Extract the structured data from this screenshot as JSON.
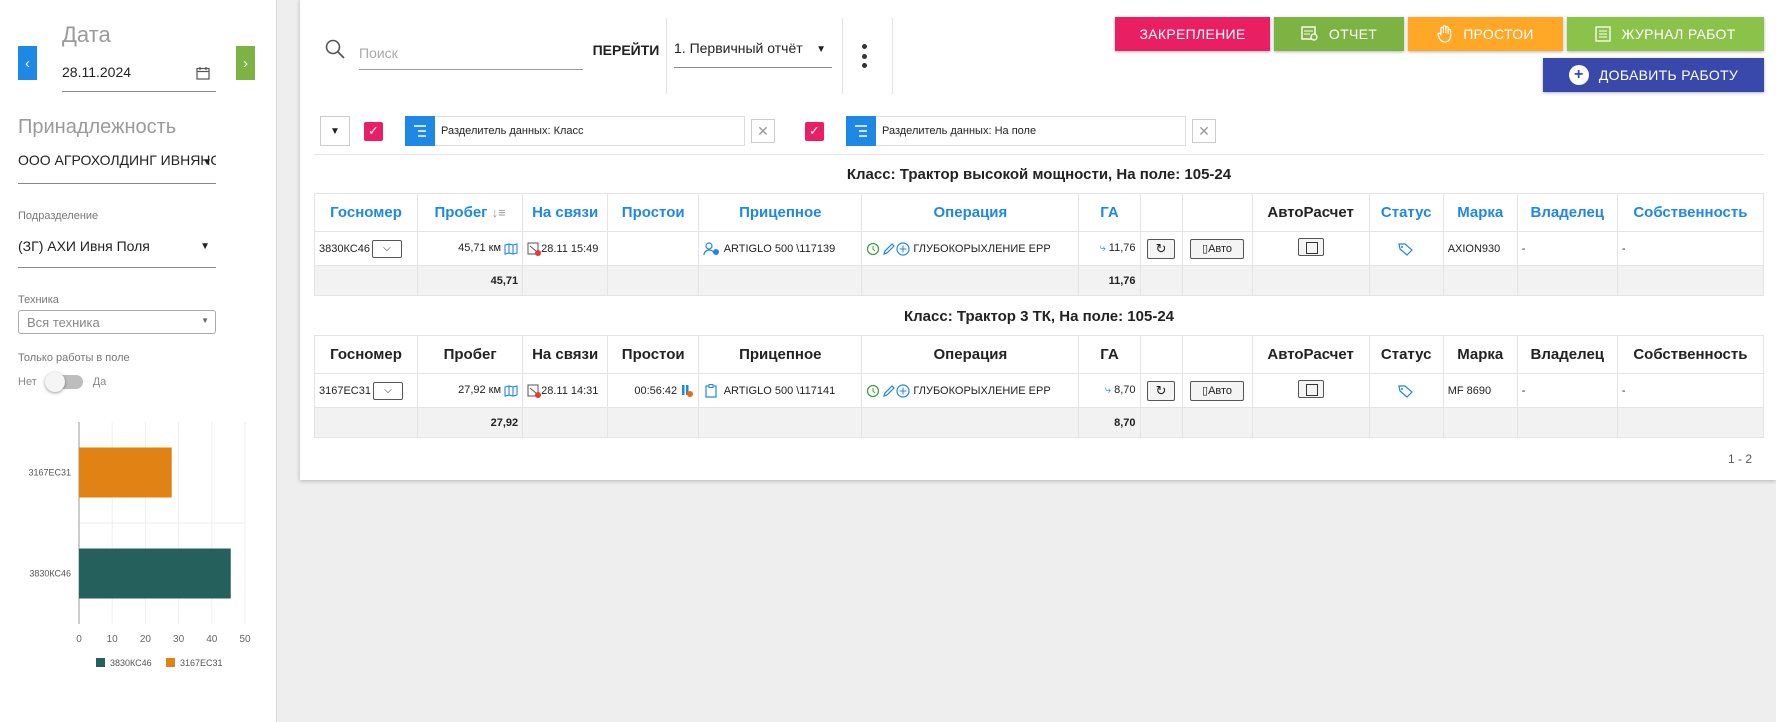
{
  "sidebar": {
    "date_title": "Дата",
    "date_value": "28.11.2024",
    "ownership_title": "Принадлежность",
    "ownership_value": "ООО АГРОХОЛДИНГ ИВНЯНСІ",
    "dept_label": "Подразделение",
    "dept_value": "(ЗГ) АХИ Ивня Поля",
    "tech_label": "Техника",
    "tech_placeholder": "Вся техника",
    "fieldwork_label": "Только работы в поле",
    "toggle_off": "Нет",
    "toggle_on": "Да"
  },
  "chart_data": {
    "type": "bar",
    "orientation": "horizontal",
    "categories": [
      "3167ЕС31",
      "3830КС46"
    ],
    "series": [
      {
        "name": "3830КС46",
        "values": [
          null,
          45.71
        ],
        "color": "#26605c"
      },
      {
        "name": "3167ЕС31",
        "values": [
          27.92,
          null
        ],
        "color": "#e08214"
      }
    ],
    "xticks": [
      "0",
      "10",
      "20",
      "30",
      "40",
      "50"
    ],
    "xlim": [
      0,
      50
    ],
    "legend": "bottom"
  },
  "toolbar": {
    "search_placeholder": "Поиск",
    "go_label": "ПЕРЕЙТИ",
    "report_value": "1. Первичный отчёт",
    "pin_label": "ЗАКРЕПЛЕНИЕ",
    "report_label": "ОТЧЕТ",
    "idle_label": "ПРОСТОИ",
    "log_label": "ЖУРНАЛ РАБОТ",
    "add_label": "ДОБАВИТЬ РАБОТУ"
  },
  "grouping": {
    "chip1": "Разделитель данных: Класс",
    "chip2": "Разделитель данных: На поле"
  },
  "columns": [
    "Госномер",
    "Пробег",
    "На связи",
    "Простои",
    "Прицепное",
    "Операция",
    "ГА",
    "",
    "",
    "АвтоРасчет",
    "Статус",
    "Марка",
    "Владелец",
    "Собственность"
  ],
  "groups": [
    {
      "title": "Класс: Трактор высокой мощности, На поле: 105-24",
      "row": {
        "gos": "3830КС46",
        "mileage": "45,71 км",
        "online": "28.11 15:49",
        "idle": "",
        "trailer": "ARTIGLO 500 \\117139",
        "operation": "ГЛУБОКОРЫХЛЕНИЕ ЕРР",
        "ga": "11,76",
        "auto": "Авто",
        "brand": "AXION930",
        "owner": "-",
        "property": "-"
      },
      "sum": {
        "mileage": "45,71",
        "ga": "11,76"
      }
    },
    {
      "title": "Класс: Трактор 3 ТК, На поле: 105-24",
      "row": {
        "gos": "3167ЕС31",
        "mileage": "27,92 км",
        "online": "28.11 14:31",
        "idle": "00:56:42",
        "trailer": "ARTIGLO 500 \\117141",
        "operation": "ГЛУБОКОРЫХЛЕНИЕ ЕРР",
        "ga": "8,70",
        "auto": "Авто",
        "brand": "MF 8690",
        "owner": "-",
        "property": "-"
      },
      "sum": {
        "mileage": "27,92",
        "ga": "8,70"
      }
    }
  ],
  "pager": "1 - 2"
}
